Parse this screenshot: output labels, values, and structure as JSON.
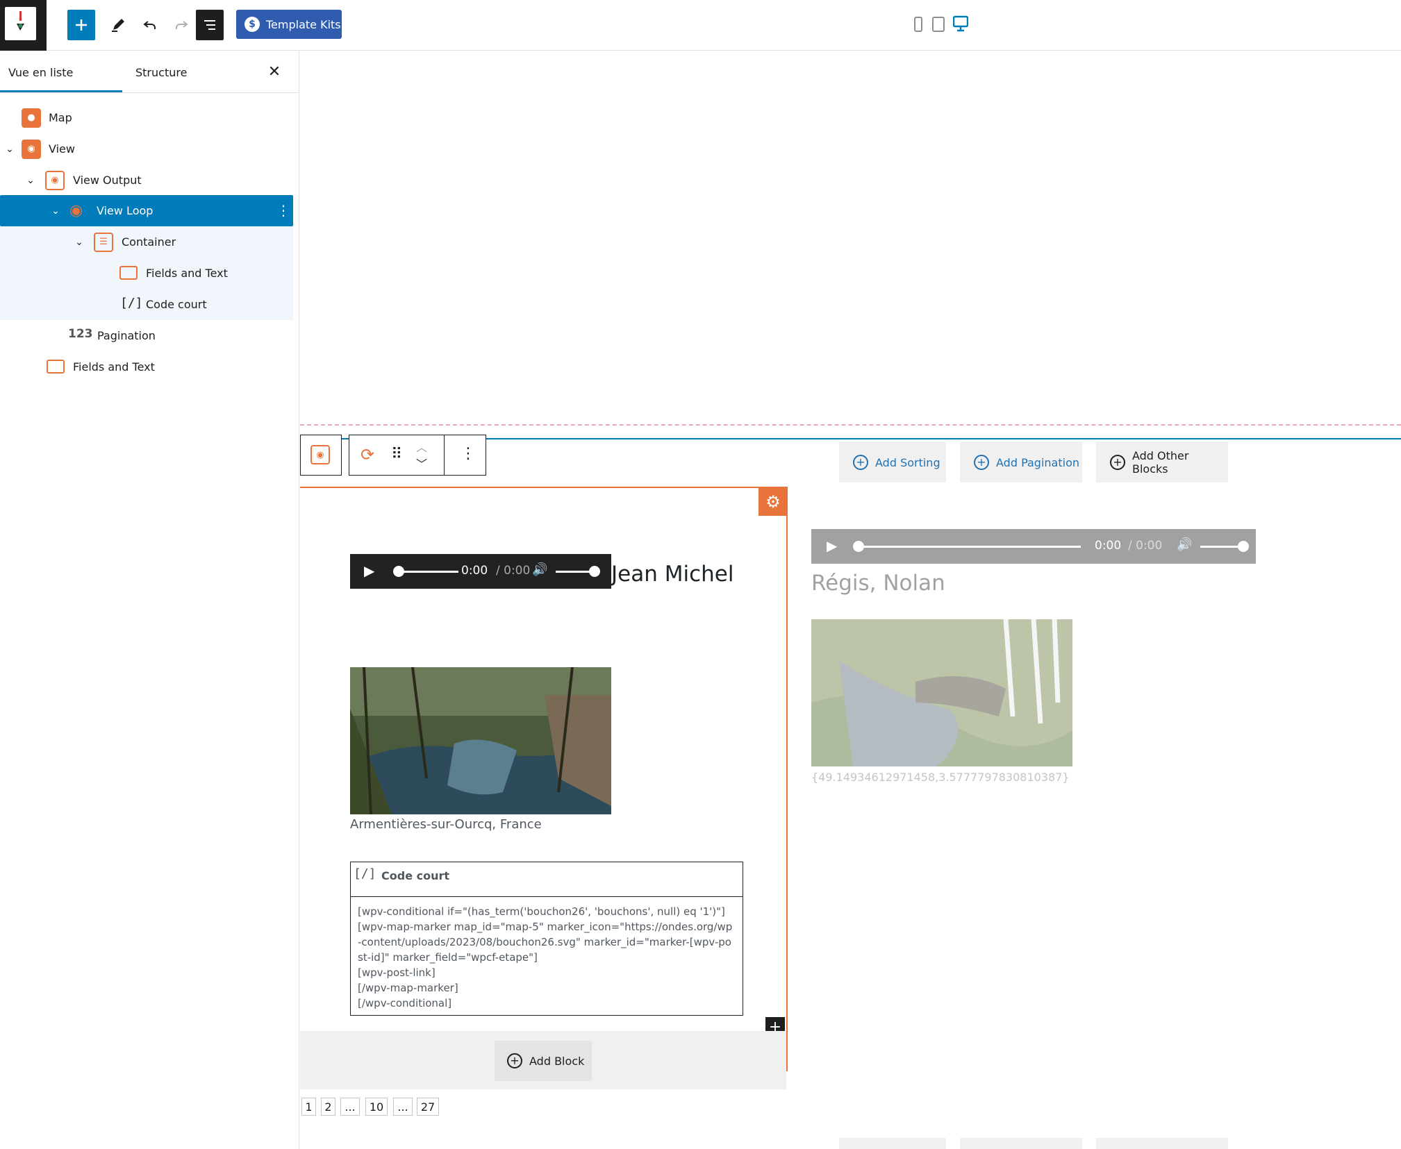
{
  "toolbar": {
    "template_kits_label": "Template Kits"
  },
  "sidebar": {
    "tab_list": "Vue en liste",
    "tab_structure": "Structure",
    "items": [
      {
        "label": "Map"
      },
      {
        "label": "View"
      },
      {
        "label": "View Output"
      },
      {
        "label": "View Loop"
      },
      {
        "label": "Container"
      },
      {
        "label": "Fields and Text"
      },
      {
        "label": "Code court"
      },
      {
        "label": "Pagination"
      },
      {
        "label": "Fields and Text"
      }
    ]
  },
  "view_controls": {
    "add_sorting": "Add Sorting",
    "add_pagination": "Add Pagination",
    "add_other_blocks": "Add Other Blocks"
  },
  "item1": {
    "audio_time": "0:00",
    "audio_duration": "/ 0:00",
    "title": "Jean Michel",
    "location": "Armentières-sur-Ourcq, France",
    "code_block_title": "Code court",
    "code_text": "[wpv-conditional if=\"(has_term('bouchon26', 'bouchons', null) eq '1')\"]\n[wpv-map-marker map_id=\"map-5\" marker_icon=\"https://ondes.org/wp-content/uploads/2023/08/bouchon26.svg\" marker_id=\"marker-[wpv-post-id]\" marker_field=\"wpcf-etape\"]\n[wpv-post-link]\n[/wpv-map-marker]\n[/wpv-conditional]",
    "add_block": "Add Block"
  },
  "item2": {
    "audio_time": "0:00",
    "audio_duration": "/ 0:00",
    "title": "Régis, Nolan",
    "coords": "{49.14934612971458,3.5777797830810387}"
  },
  "pagination": [
    "1",
    "2",
    "...",
    "10",
    "...",
    "27"
  ],
  "colors": {
    "accent": "#007cba",
    "orange": "#e8743b",
    "dark": "#1e1e1e"
  }
}
